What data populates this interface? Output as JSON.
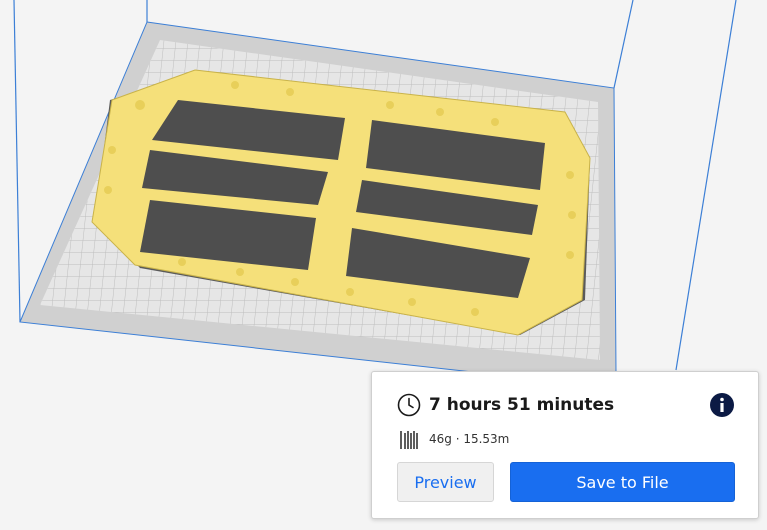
{
  "viewport": {
    "model_color": "#f5e07a",
    "build_plate_color": "#e6e6e6",
    "grid_color": "#bdbdbd",
    "volume_edge_color": "#3c7fd6"
  },
  "print_panel": {
    "time_estimate": "7 hours 51 minutes",
    "material_estimate": "46g · 15.53m",
    "preview_label": "Preview",
    "save_label": "Save to File",
    "time_icon": "clock-icon",
    "info_icon": "info-icon",
    "material_icon": "spool-icon",
    "accent_color": "#196ef0"
  }
}
